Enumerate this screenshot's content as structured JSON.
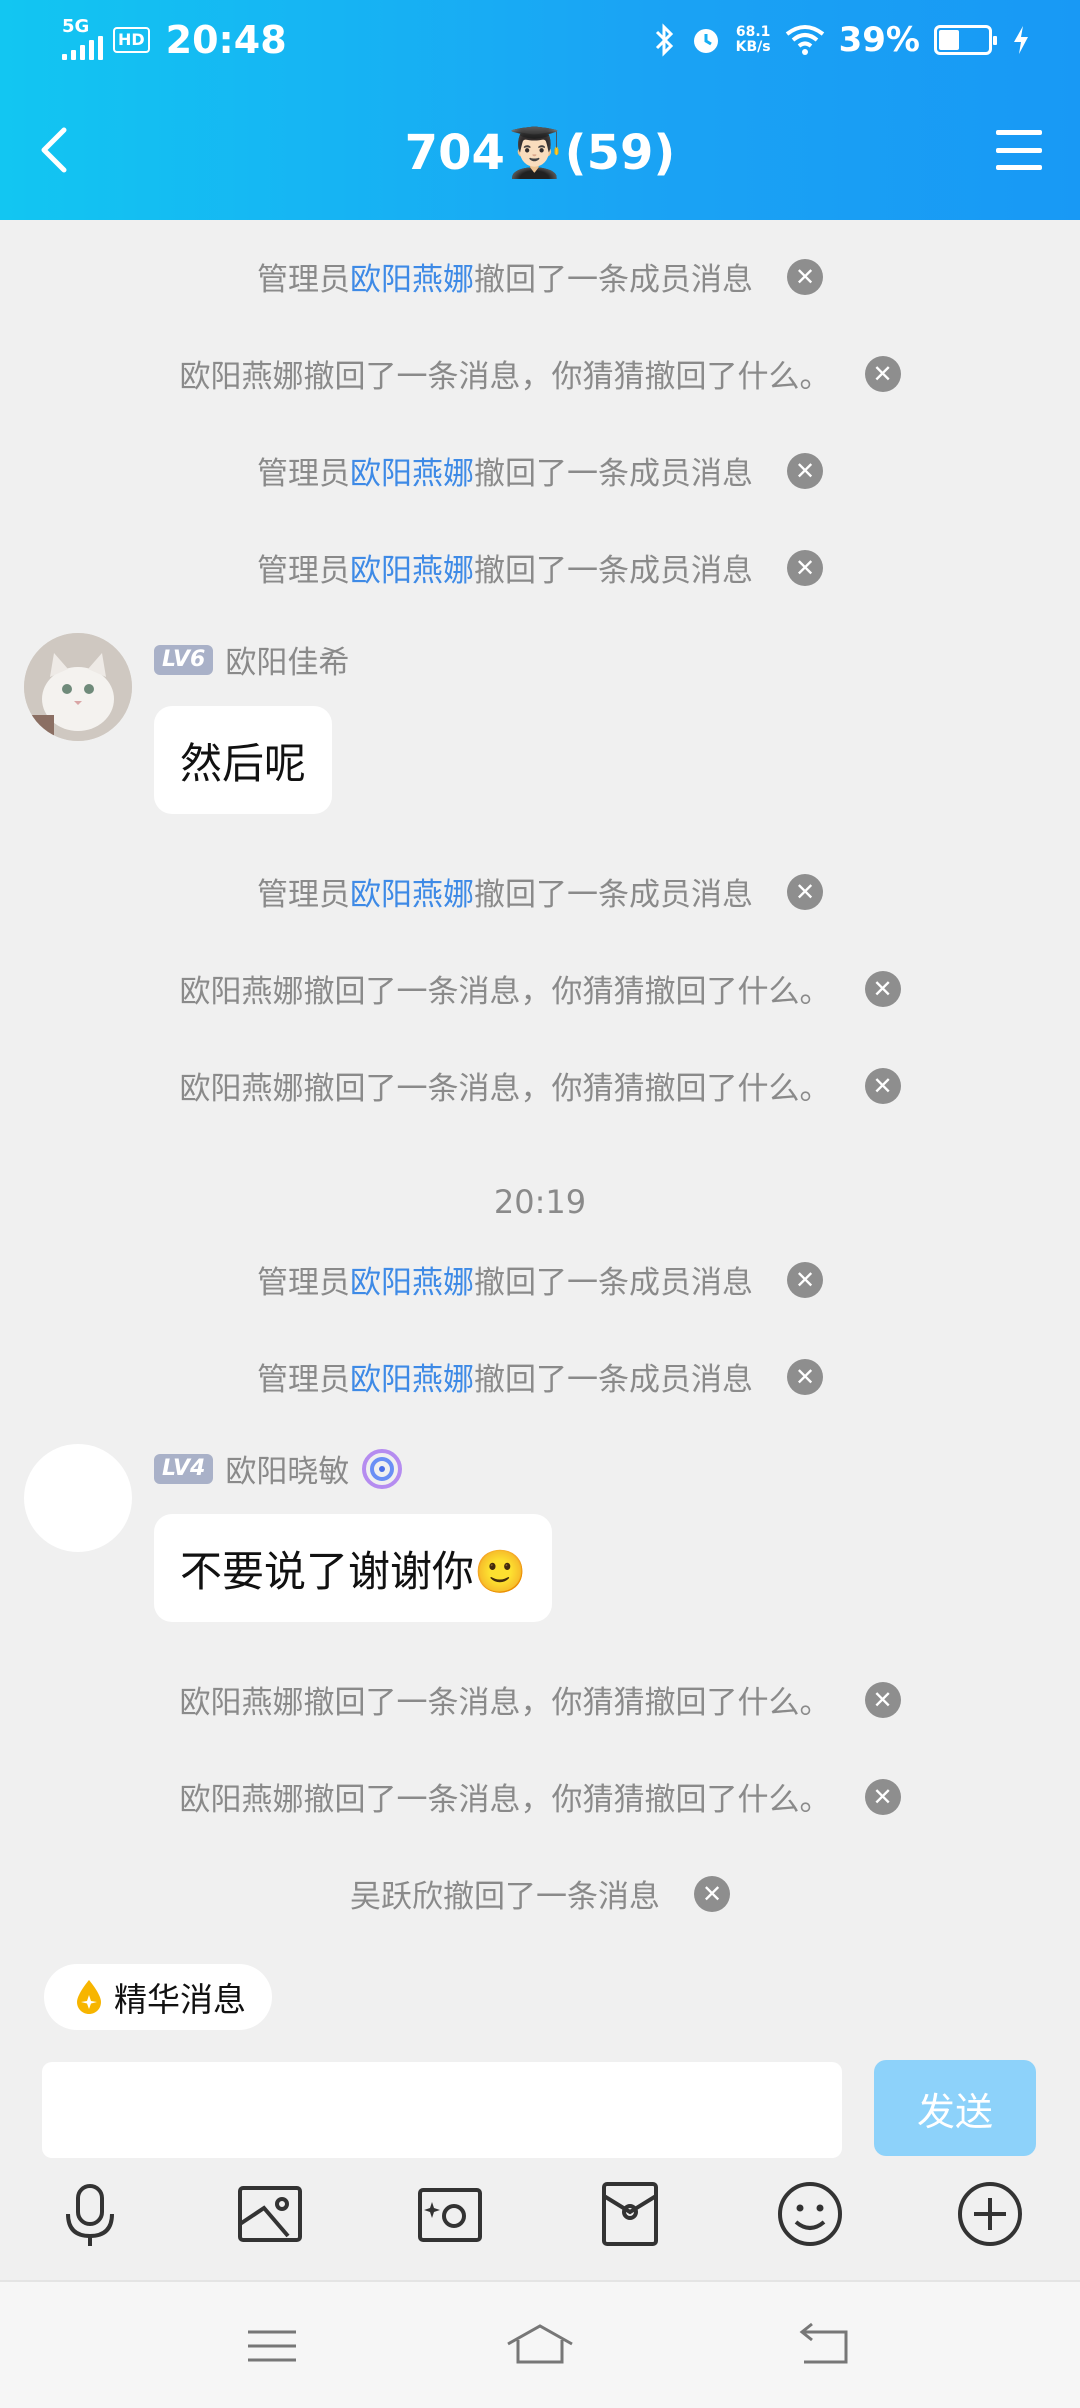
{
  "status_bar": {
    "network": "5G",
    "hd": "HD",
    "time": "20:48",
    "speed_value": "68.1",
    "speed_unit": "KB/s",
    "battery_percent": "39%",
    "battery_level": 0.39
  },
  "header": {
    "title": "704👨🏻‍🎓(59)"
  },
  "messages": [
    {
      "type": "system",
      "pre": "管理员",
      "highlight": "欧阳燕娜",
      "post": "撤回了一条成员消息"
    },
    {
      "type": "system",
      "pre": "欧阳燕娜撤回了一条消息，你猜猜撤回了什么。",
      "highlight": "",
      "post": ""
    },
    {
      "type": "system",
      "pre": "管理员",
      "highlight": "欧阳燕娜",
      "post": "撤回了一条成员消息"
    },
    {
      "type": "system",
      "pre": "管理员",
      "highlight": "欧阳燕娜",
      "post": "撤回了一条成员消息"
    },
    {
      "type": "chat",
      "level": "LV6",
      "name": "欧阳佳希",
      "text": "然后呢"
    },
    {
      "type": "system",
      "pre": "管理员",
      "highlight": "欧阳燕娜",
      "post": "撤回了一条成员消息"
    },
    {
      "type": "system",
      "pre": "欧阳燕娜撤回了一条消息，你猜猜撤回了什么。",
      "highlight": "",
      "post": ""
    },
    {
      "type": "system",
      "pre": "欧阳燕娜撤回了一条消息，你猜猜撤回了什么。",
      "highlight": "",
      "post": ""
    },
    {
      "type": "time",
      "text": "20:19"
    },
    {
      "type": "system",
      "pre": "管理员",
      "highlight": "欧阳燕娜",
      "post": "撤回了一条成员消息"
    },
    {
      "type": "system",
      "pre": "管理员",
      "highlight": "欧阳燕娜",
      "post": "撤回了一条成员消息"
    },
    {
      "type": "chat",
      "level": "LV4",
      "name": "欧阳晓敏",
      "text": "不要说了谢谢你🙂"
    },
    {
      "type": "system",
      "pre": "欧阳燕娜撤回了一条消息，你猜猜撤回了什么。",
      "highlight": "",
      "post": ""
    },
    {
      "type": "system",
      "pre": "欧阳燕娜撤回了一条消息，你猜猜撤回了什么。",
      "highlight": "",
      "post": ""
    },
    {
      "type": "system",
      "pre": "吴跃欣撤回了一条消息",
      "highlight": "",
      "post": ""
    }
  ],
  "close_glyph": "✕",
  "bottom": {
    "featured_label": "精华消息",
    "input_placeholder": "",
    "send_label": "发送",
    "tools": [
      "mic-icon",
      "image-icon",
      "camera-icon",
      "red-packet-icon",
      "emoji-icon",
      "plus-icon"
    ]
  },
  "navbar": [
    "menu-icon",
    "home-icon",
    "back-icon"
  ],
  "colors": {
    "header_start": "#12c6f2",
    "header_end": "#1899f5",
    "highlight_name": "#3e8ae6",
    "send_button": "#8dd2fa",
    "level_badge": "#a9b1c8"
  }
}
